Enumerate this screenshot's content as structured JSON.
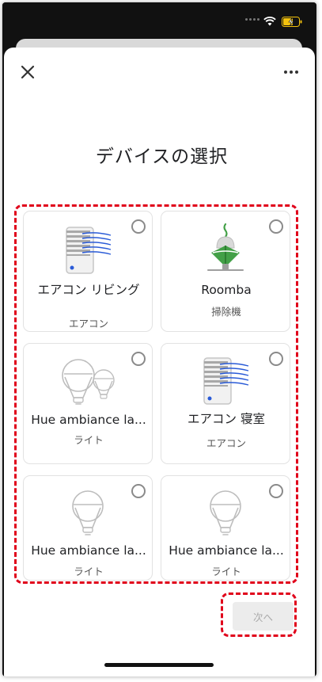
{
  "header": {
    "title": "デバイスの選択",
    "close_icon": "close-icon",
    "more_icon": "more-horizontal-icon"
  },
  "devices": [
    {
      "name": "エアコン リビング",
      "type": "エアコン",
      "icon": "air-conditioner-icon",
      "selected": false
    },
    {
      "name": "Roomba",
      "type": "掃除機",
      "icon": "robot-vacuum-icon",
      "selected": false
    },
    {
      "name": "Hue ambiance la...",
      "type": "ライト",
      "icon": "bulbs-icon",
      "selected": false
    },
    {
      "name": "エアコン 寝室",
      "type": "エアコン",
      "icon": "air-conditioner-icon",
      "selected": false
    },
    {
      "name": "Hue ambiance la...",
      "type": "ライト",
      "icon": "bulb-icon",
      "selected": false
    },
    {
      "name": "Hue ambiance la...",
      "type": "ライト",
      "icon": "bulb-icon",
      "selected": false
    }
  ],
  "footer": {
    "next_label": "次へ",
    "next_enabled": false
  },
  "colors": {
    "highlight": "#e0001a",
    "vacuum_green": "#43a047",
    "ac_blue": "#2a5bd7",
    "disabled_button": "#ececec"
  }
}
